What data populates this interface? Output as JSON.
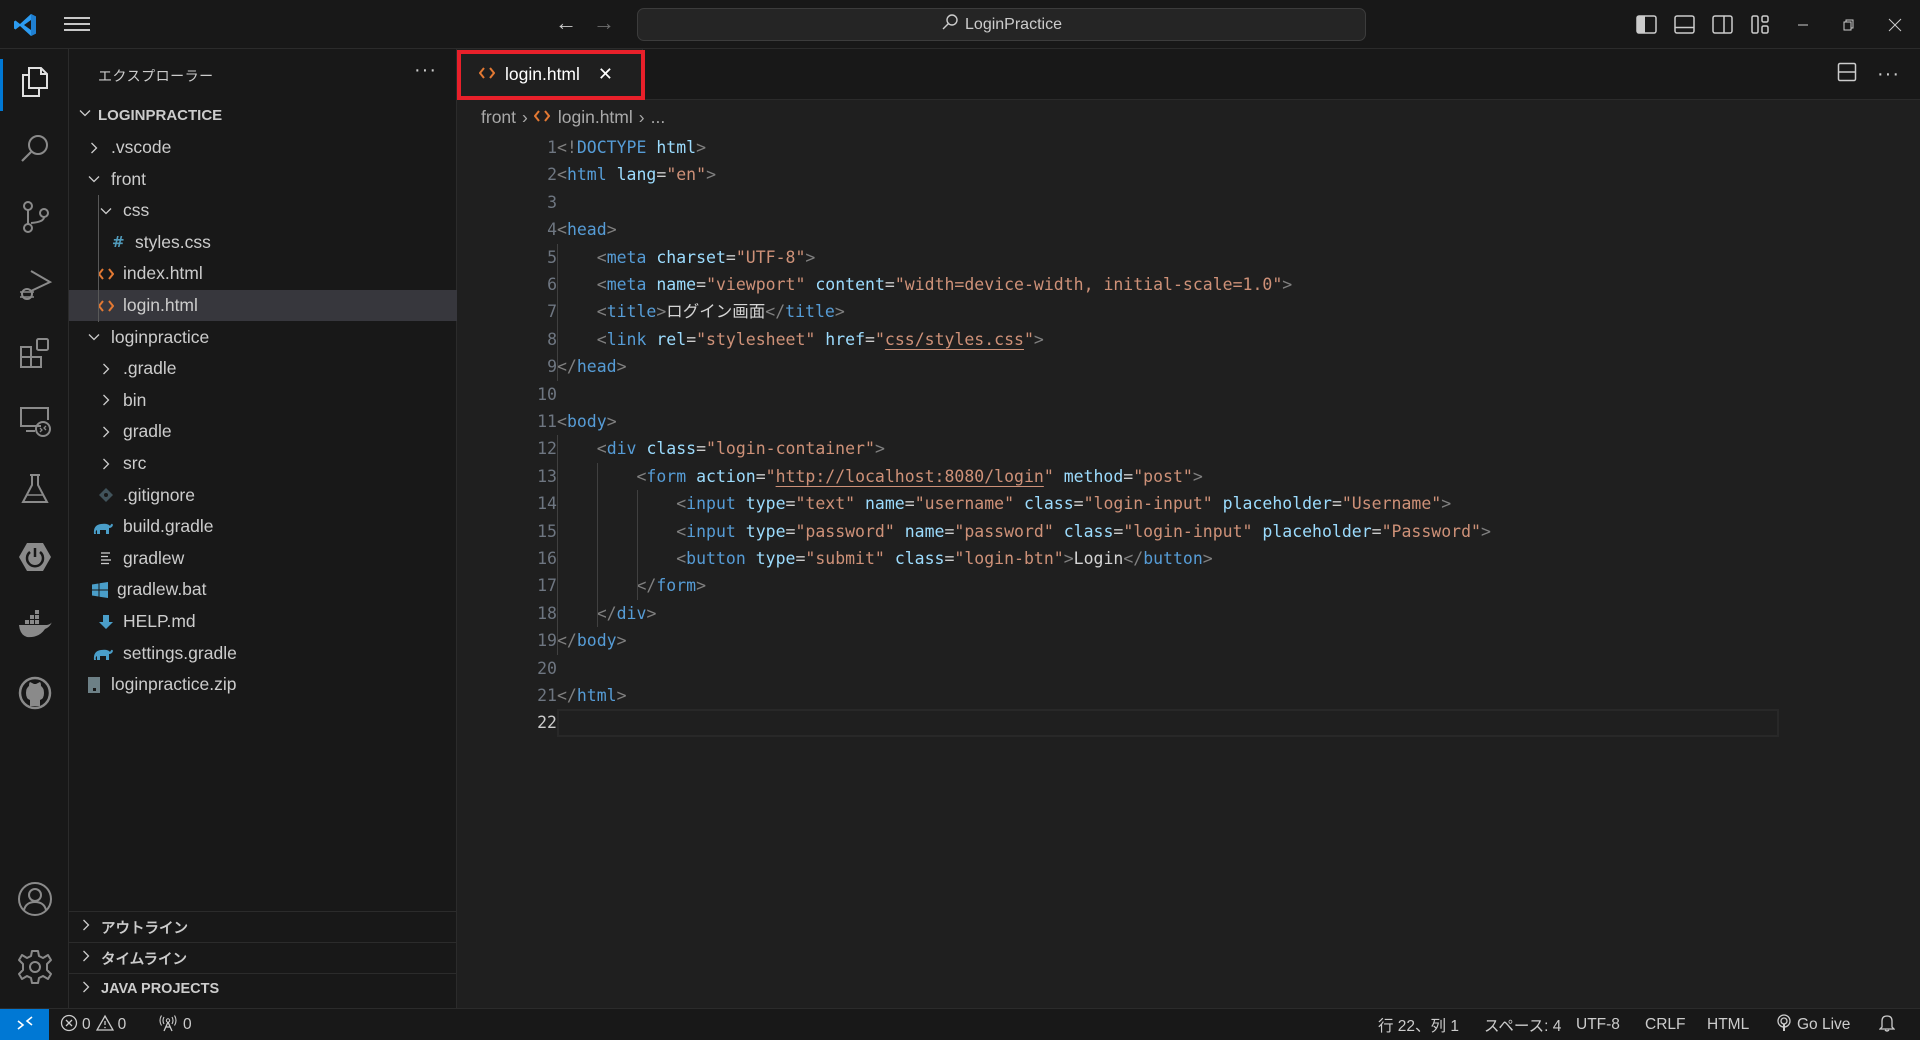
{
  "titlebar": {
    "search_label": "LoginPractice",
    "icons": [
      "vscode-logo-icon",
      "menu-icon",
      "back-arrow-icon",
      "forward-arrow-icon",
      "toggle-primary-sidebar-icon",
      "toggle-panel-icon",
      "toggle-secondary-sidebar-icon",
      "customize-layout-icon",
      "minimize-icon",
      "restore-icon",
      "close-icon"
    ]
  },
  "activity_bar": {
    "items": [
      {
        "name": "explorer",
        "icon": "files-icon",
        "active": true
      },
      {
        "name": "search",
        "icon": "search-icon"
      },
      {
        "name": "source-control",
        "icon": "source-control-icon"
      },
      {
        "name": "run-debug",
        "icon": "run-debug-icon"
      },
      {
        "name": "extensions",
        "icon": "extensions-icon"
      },
      {
        "name": "remote-explorer",
        "icon": "remote-explorer-icon"
      },
      {
        "name": "testing",
        "icon": "flask-icon"
      },
      {
        "name": "spring-boot",
        "icon": "spring-boot-icon"
      },
      {
        "name": "docker",
        "icon": "docker-icon"
      },
      {
        "name": "github",
        "icon": "github-icon"
      }
    ],
    "bottom": [
      {
        "name": "accounts",
        "icon": "account-icon"
      },
      {
        "name": "manage",
        "icon": "gear-icon"
      }
    ]
  },
  "sidebar": {
    "title": "エクスプローラー",
    "more": "···",
    "root": "LOGINPRACTICE",
    "tree": [
      {
        "label": ".vscode",
        "type": "folder",
        "expanded": false,
        "depth": 1
      },
      {
        "label": "front",
        "type": "folder",
        "expanded": true,
        "depth": 1
      },
      {
        "label": "css",
        "type": "folder",
        "expanded": true,
        "depth": 2
      },
      {
        "label": "styles.css",
        "type": "css",
        "depth": 3
      },
      {
        "label": "index.html",
        "type": "html",
        "depth": 2
      },
      {
        "label": "login.html",
        "type": "html",
        "depth": 2,
        "selected": true
      },
      {
        "label": "loginpractice",
        "type": "folder",
        "expanded": true,
        "depth": 1
      },
      {
        "label": ".gradle",
        "type": "folder",
        "expanded": false,
        "depth": 2
      },
      {
        "label": "bin",
        "type": "folder",
        "expanded": false,
        "depth": 2
      },
      {
        "label": "gradle",
        "type": "folder",
        "expanded": false,
        "depth": 2
      },
      {
        "label": "src",
        "type": "folder",
        "expanded": false,
        "depth": 2
      },
      {
        "label": ".gitignore",
        "type": "git",
        "depth": 2
      },
      {
        "label": "build.gradle",
        "type": "gradle",
        "depth": 2
      },
      {
        "label": "gradlew",
        "type": "text",
        "depth": 2
      },
      {
        "label": "gradlew.bat",
        "type": "windows",
        "depth": 2
      },
      {
        "label": "HELP.md",
        "type": "markdown",
        "depth": 2
      },
      {
        "label": "settings.gradle",
        "type": "gradle",
        "depth": 2
      },
      {
        "label": "loginpractice.zip",
        "type": "zip",
        "depth": 1
      }
    ],
    "panels": [
      "アウトライン",
      "タイムライン",
      "JAVA PROJECTS"
    ]
  },
  "editor": {
    "tabs": [
      {
        "label": "login.html",
        "active": true,
        "close": "✕"
      }
    ],
    "breadcrumb": [
      "front",
      "login.html",
      "..."
    ],
    "current_line": 22,
    "lines": [
      [
        [
          "br",
          "<!"
        ],
        [
          "tag",
          "DOCTYPE"
        ],
        [
          "txt",
          " "
        ],
        [
          "attr",
          "html"
        ],
        [
          "br",
          ">"
        ]
      ],
      [
        [
          "br",
          "<"
        ],
        [
          "tag",
          "html"
        ],
        [
          "txt",
          " "
        ],
        [
          "attr",
          "lang"
        ],
        [
          "eq",
          "="
        ],
        [
          "str",
          "\"en\""
        ],
        [
          "br",
          ">"
        ]
      ],
      [],
      [
        [
          "br",
          "<"
        ],
        [
          "tag",
          "head"
        ],
        [
          "br",
          ">"
        ]
      ],
      [
        [
          "txt",
          "    "
        ],
        [
          "br",
          "<"
        ],
        [
          "tag",
          "meta"
        ],
        [
          "txt",
          " "
        ],
        [
          "attr",
          "charset"
        ],
        [
          "eq",
          "="
        ],
        [
          "str",
          "\"UTF-8\""
        ],
        [
          "br",
          ">"
        ]
      ],
      [
        [
          "txt",
          "    "
        ],
        [
          "br",
          "<"
        ],
        [
          "tag",
          "meta"
        ],
        [
          "txt",
          " "
        ],
        [
          "attr",
          "name"
        ],
        [
          "eq",
          "="
        ],
        [
          "str",
          "\"viewport\""
        ],
        [
          "txt",
          " "
        ],
        [
          "attr",
          "content"
        ],
        [
          "eq",
          "="
        ],
        [
          "str",
          "\"width=device-width, initial-scale=1.0\""
        ],
        [
          "br",
          ">"
        ]
      ],
      [
        [
          "txt",
          "    "
        ],
        [
          "br",
          "<"
        ],
        [
          "tag",
          "title"
        ],
        [
          "br",
          ">"
        ],
        [
          "txt",
          "ログイン画面"
        ],
        [
          "br",
          "</"
        ],
        [
          "tag",
          "title"
        ],
        [
          "br",
          ">"
        ]
      ],
      [
        [
          "txt",
          "    "
        ],
        [
          "br",
          "<"
        ],
        [
          "tag",
          "link"
        ],
        [
          "txt",
          " "
        ],
        [
          "attr",
          "rel"
        ],
        [
          "eq",
          "="
        ],
        [
          "str",
          "\"stylesheet\""
        ],
        [
          "txt",
          " "
        ],
        [
          "attr",
          "href"
        ],
        [
          "eq",
          "="
        ],
        [
          "str",
          "\""
        ],
        [
          "strlink",
          "css/styles.css"
        ],
        [
          "str",
          "\""
        ],
        [
          "br",
          ">"
        ]
      ],
      [
        [
          "br",
          "</"
        ],
        [
          "tag",
          "head"
        ],
        [
          "br",
          ">"
        ]
      ],
      [],
      [
        [
          "br",
          "<"
        ],
        [
          "tag",
          "body"
        ],
        [
          "br",
          ">"
        ]
      ],
      [
        [
          "txt",
          "    "
        ],
        [
          "br",
          "<"
        ],
        [
          "tag",
          "div"
        ],
        [
          "txt",
          " "
        ],
        [
          "attr",
          "class"
        ],
        [
          "eq",
          "="
        ],
        [
          "str",
          "\"login-container\""
        ],
        [
          "br",
          ">"
        ]
      ],
      [
        [
          "txt",
          "        "
        ],
        [
          "br",
          "<"
        ],
        [
          "tag",
          "form"
        ],
        [
          "txt",
          " "
        ],
        [
          "attr",
          "action"
        ],
        [
          "eq",
          "="
        ],
        [
          "str",
          "\""
        ],
        [
          "strlink",
          "http://localhost:8080/login"
        ],
        [
          "str",
          "\""
        ],
        [
          "txt",
          " "
        ],
        [
          "attr",
          "method"
        ],
        [
          "eq",
          "="
        ],
        [
          "str",
          "\"post\""
        ],
        [
          "br",
          ">"
        ]
      ],
      [
        [
          "txt",
          "            "
        ],
        [
          "br",
          "<"
        ],
        [
          "tag",
          "input"
        ],
        [
          "txt",
          " "
        ],
        [
          "attr",
          "type"
        ],
        [
          "eq",
          "="
        ],
        [
          "str",
          "\"text\""
        ],
        [
          "txt",
          " "
        ],
        [
          "attr",
          "name"
        ],
        [
          "eq",
          "="
        ],
        [
          "str",
          "\"username\""
        ],
        [
          "txt",
          " "
        ],
        [
          "attr",
          "class"
        ],
        [
          "eq",
          "="
        ],
        [
          "str",
          "\"login-input\""
        ],
        [
          "txt",
          " "
        ],
        [
          "attr",
          "placeholder"
        ],
        [
          "eq",
          "="
        ],
        [
          "str",
          "\"Username\""
        ],
        [
          "br",
          ">"
        ]
      ],
      [
        [
          "txt",
          "            "
        ],
        [
          "br",
          "<"
        ],
        [
          "tag",
          "input"
        ],
        [
          "txt",
          " "
        ],
        [
          "attr",
          "type"
        ],
        [
          "eq",
          "="
        ],
        [
          "str",
          "\"password\""
        ],
        [
          "txt",
          " "
        ],
        [
          "attr",
          "name"
        ],
        [
          "eq",
          "="
        ],
        [
          "str",
          "\"password\""
        ],
        [
          "txt",
          " "
        ],
        [
          "attr",
          "class"
        ],
        [
          "eq",
          "="
        ],
        [
          "str",
          "\"login-input\""
        ],
        [
          "txt",
          " "
        ],
        [
          "attr",
          "placeholder"
        ],
        [
          "eq",
          "="
        ],
        [
          "str",
          "\"Password\""
        ],
        [
          "br",
          ">"
        ]
      ],
      [
        [
          "txt",
          "            "
        ],
        [
          "br",
          "<"
        ],
        [
          "tag",
          "button"
        ],
        [
          "txt",
          " "
        ],
        [
          "attr",
          "type"
        ],
        [
          "eq",
          "="
        ],
        [
          "str",
          "\"submit\""
        ],
        [
          "txt",
          " "
        ],
        [
          "attr",
          "class"
        ],
        [
          "eq",
          "="
        ],
        [
          "str",
          "\"login-btn\""
        ],
        [
          "br",
          ">"
        ],
        [
          "txt",
          "Login"
        ],
        [
          "br",
          "</"
        ],
        [
          "tag",
          "button"
        ],
        [
          "br",
          ">"
        ]
      ],
      [
        [
          "txt",
          "        "
        ],
        [
          "br",
          "</"
        ],
        [
          "tag",
          "form"
        ],
        [
          "br",
          ">"
        ]
      ],
      [
        [
          "txt",
          "    "
        ],
        [
          "br",
          "</"
        ],
        [
          "tag",
          "div"
        ],
        [
          "br",
          ">"
        ]
      ],
      [
        [
          "br",
          "</"
        ],
        [
          "tag",
          "body"
        ],
        [
          "br",
          ">"
        ]
      ],
      [],
      [
        [
          "br",
          "</"
        ],
        [
          "tag",
          "html"
        ],
        [
          "br",
          ">"
        ]
      ],
      []
    ]
  },
  "statusbar": {
    "errors": "0",
    "warnings": "0",
    "ports": "0",
    "cursor_position": "行 22、列 1",
    "indentation": "スペース: 4",
    "encoding": "UTF-8",
    "eol": "CRLF",
    "language": "HTML",
    "go_live": "Go Live"
  },
  "colors": {
    "accent": "#0078d4",
    "highlight_box": "#e8202a",
    "html_icon": "#e37933",
    "css_icon": "#519aba",
    "gradle_icon": "#4a9ec9"
  }
}
